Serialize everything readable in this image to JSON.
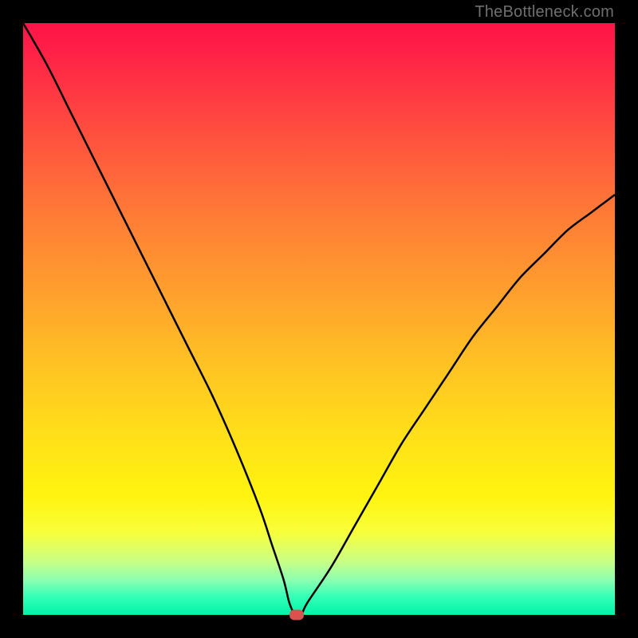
{
  "watermark": "TheBottleneck.com",
  "chart_data": {
    "type": "line",
    "title": "",
    "xlabel": "",
    "ylabel": "",
    "xlim": [
      0,
      100
    ],
    "ylim": [
      0,
      100
    ],
    "series": [
      {
        "name": "bottleneck-curve",
        "x": [
          0,
          4,
          8,
          12,
          16,
          20,
          24,
          28,
          32,
          36,
          40,
          42,
          44,
          45,
          46,
          47,
          48,
          52,
          56,
          60,
          64,
          68,
          72,
          76,
          80,
          84,
          88,
          92,
          96,
          100
        ],
        "values": [
          100,
          93,
          85,
          77,
          69,
          61,
          53,
          45,
          37,
          28,
          18,
          12,
          6,
          2,
          0,
          0,
          2,
          8,
          15,
          22,
          29,
          35,
          41,
          47,
          52,
          57,
          61,
          65,
          68,
          71
        ]
      }
    ],
    "marker": {
      "x": 46.2,
      "y": 0,
      "color": "#d6534e"
    },
    "gradient_stops": [
      {
        "pos": 0.0,
        "color": "#ff1448"
      },
      {
        "pos": 0.5,
        "color": "#ffb326"
      },
      {
        "pos": 0.8,
        "color": "#fff40f"
      },
      {
        "pos": 1.0,
        "color": "#00f3a8"
      }
    ]
  }
}
